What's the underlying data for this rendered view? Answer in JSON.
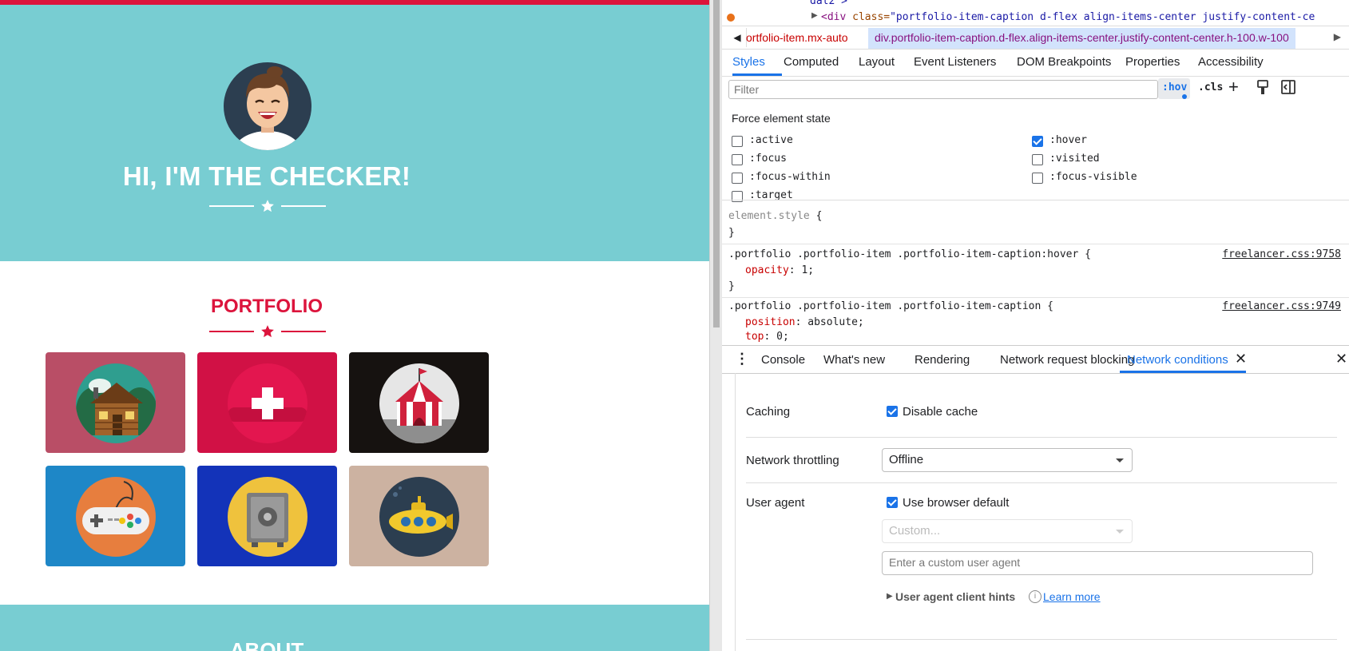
{
  "page": {
    "hero_title": "HI, I'M THE CHECKER!",
    "portfolio_title": "PORTFOLIO",
    "about_title": "ABOUT",
    "tiles": [
      {
        "name": "cabin",
        "bg": "#b94e66"
      },
      {
        "name": "cake",
        "bg": "#d11145"
      },
      {
        "name": "circus-tent",
        "bg": "#161210"
      },
      {
        "name": "game-controller",
        "bg": "#1e87c7"
      },
      {
        "name": "safe",
        "bg": "#1333b9"
      },
      {
        "name": "submarine",
        "bg": "#ccb2a1"
      }
    ],
    "colors": {
      "accent": "#dc143c",
      "masthead": "#78cdd2"
    }
  },
  "devtools": {
    "elements": {
      "prev_line": "dal2 >",
      "tag_open": "<div",
      "attr_name": " class=",
      "attr_value": "\"portfolio-item-caption d-flex align-items-center justify-content-ce"
    },
    "breadcrumbs": [
      "ortfolio-item.mx-auto",
      "div.portfolio-item-caption.d-flex.align-items-center.justify-content-center.h-100.w-100"
    ],
    "style_tabs": [
      "Styles",
      "Computed",
      "Layout",
      "Event Listeners",
      "DOM Breakpoints",
      "Properties",
      "Accessibility"
    ],
    "filter_placeholder": "Filter",
    "hov_label": ":hov",
    "cls_label": ".cls",
    "force_state": {
      "label": "Force element state",
      "left": [
        {
          "label": ":active",
          "checked": false
        },
        {
          "label": ":focus",
          "checked": false
        },
        {
          "label": ":focus-within",
          "checked": false
        },
        {
          "label": ":target",
          "checked": false
        }
      ],
      "right": [
        {
          "label": ":hover",
          "checked": true
        },
        {
          "label": ":visited",
          "checked": false
        },
        {
          "label": ":focus-visible",
          "checked": false
        }
      ]
    },
    "rules": {
      "element_style": "element.style",
      "open_brace": " {",
      "close_brace": "}",
      "rule1_selector": ".portfolio .portfolio-item .portfolio-item-caption:hover {",
      "rule1_source": "freelancer.css:9758",
      "rule1_prop": "opacity",
      "rule1_value": ": 1;",
      "rule2_selector": ".portfolio .portfolio-item .portfolio-item-caption {",
      "rule2_source": "freelancer.css:9749",
      "rule2_props": [
        {
          "prop": "position",
          "value": ": absolute;"
        },
        {
          "prop": "top",
          "value": ": 0;"
        },
        {
          "prop": "left",
          "value": ": 0;"
        }
      ]
    },
    "drawer_tabs": [
      "Console",
      "What's new",
      "Rendering",
      "Network request blocking",
      "Network conditions"
    ],
    "network_conditions": {
      "caching_label": "Caching",
      "disable_cache_label": "Disable cache",
      "disable_cache_checked": true,
      "throttling_label": "Network throttling",
      "throttling_value": "Offline",
      "user_agent_label": "User agent",
      "use_default_label": "Use browser default",
      "use_default_checked": true,
      "custom_select": "Custom...",
      "custom_ua_placeholder": "Enter a custom user agent",
      "client_hints_label": "User agent client hints",
      "learn_more": "Learn more"
    }
  }
}
